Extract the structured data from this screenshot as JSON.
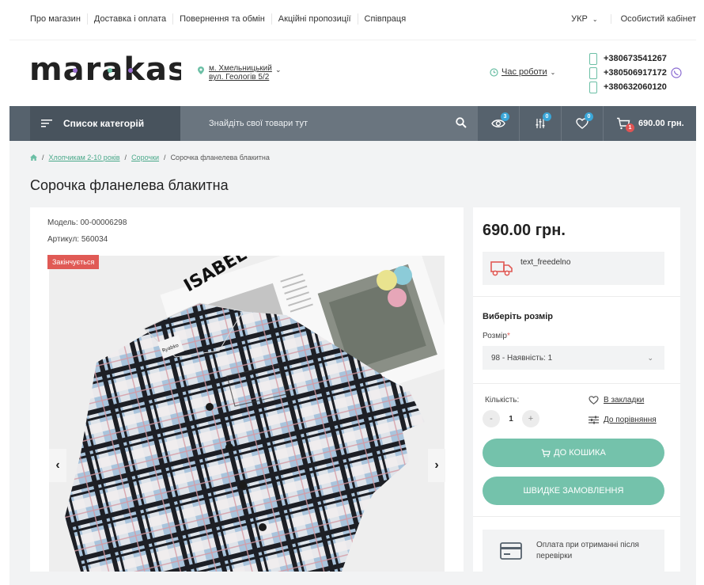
{
  "topnav": {
    "items": [
      "Про магазин",
      "Доставка і оплата",
      "Повернення та обмін",
      "Акційні пропозиції",
      "Співпраця"
    ],
    "lang": "УКР",
    "cabinet": "Особистий кабінет"
  },
  "header": {
    "logo": "marakas",
    "address_line1": "м. Хмельницький",
    "address_line2": "вул. Геологів 5/2",
    "hours": "Час роботи",
    "phones": [
      "+380673541267",
      "+380506917172",
      "+380632060120"
    ]
  },
  "navbar": {
    "categories": "Список категорій",
    "search_placeholder": "Знайдіть свої товари тут",
    "viewed_count": "3",
    "compare_count": "0",
    "wishlist_count": "0",
    "cart_count": "1",
    "cart_total": "690.00 грн."
  },
  "breadcrumb": [
    "Хлопчикам 2-10 років",
    "Сорочки",
    "Сорочка фланелева блакитна"
  ],
  "product": {
    "title": "Сорочка фланелева блакитна",
    "model": "Модель: 00-00006298",
    "sku": "Артикул: 560034",
    "badge": "Закінчується",
    "price": "690.00 грн.",
    "delivery_text": "text_freedelno",
    "size_heading": "Виберіть розмір",
    "size_label": "Розмір",
    "size_required": "*",
    "size_value": "98 - Наявність: 1",
    "qty_label": "Кількість:",
    "qty_value": "1",
    "wishlist_label": "В закладки",
    "compare_label": "До порівняння",
    "cart_button": "ДО КОШИКА",
    "quick_button": "ШВИДКЕ ЗАМОВЛЕННЯ",
    "payment_text_1": "Оплата при отриманні після",
    "payment_text_2": "перевірки"
  },
  "photo": {
    "brand_text": "ISABEL",
    "label_text": "Ryabko"
  },
  "colors": {
    "accent": "#74c2ab",
    "navbar": "#56626d",
    "sale": "#e05a55",
    "badge_blue": "#3aa6d8"
  }
}
